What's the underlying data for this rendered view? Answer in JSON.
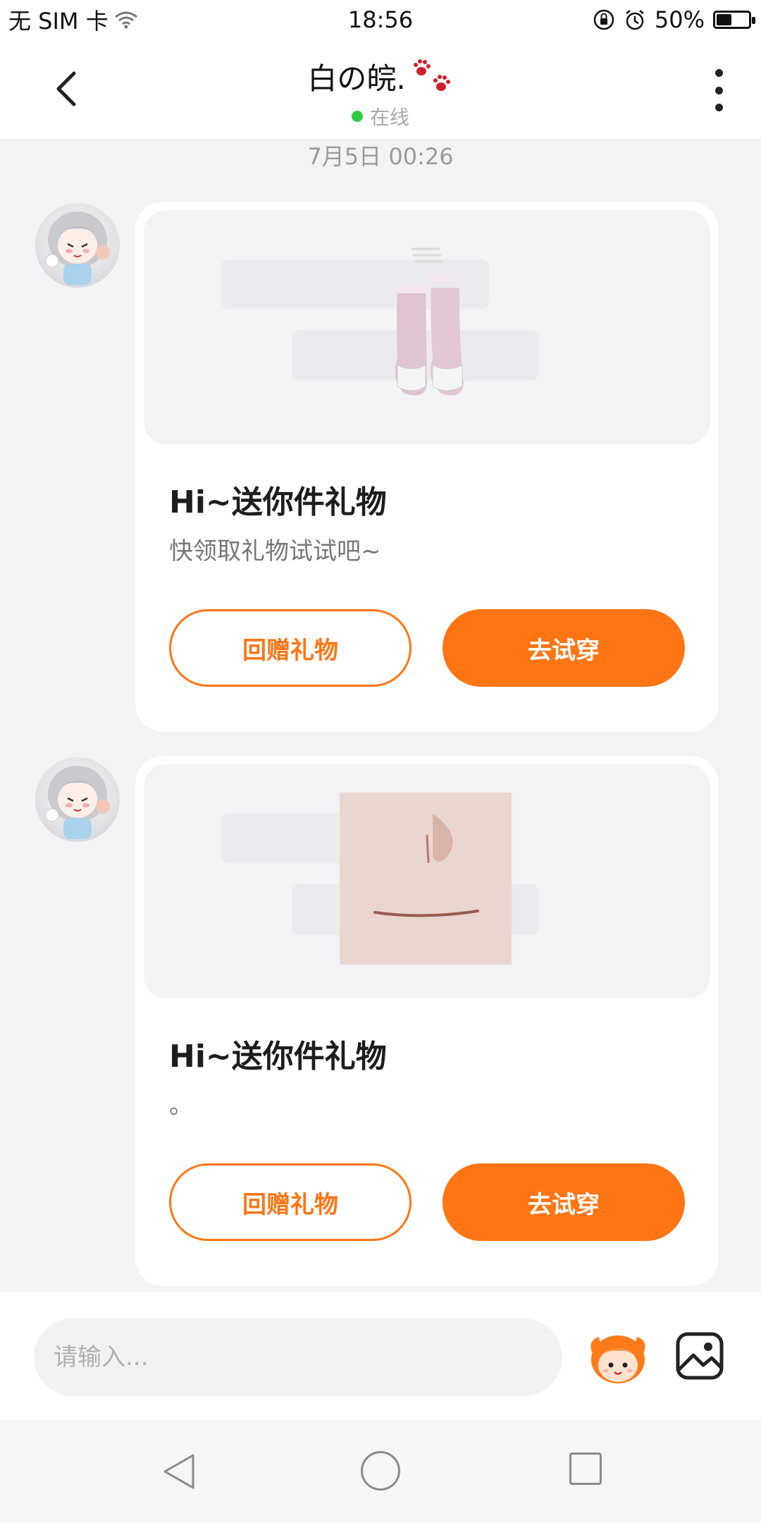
{
  "status_bar": {
    "carrier": "无 SIM 卡",
    "time": "18:56",
    "battery_percent": "50%",
    "battery_level": 0.5
  },
  "header": {
    "title": "白の皖.",
    "status": "在线"
  },
  "chat": {
    "timestamp": "7月5日 00:26",
    "messages": [
      {
        "item_type": "socks",
        "title": "Hi~送你件礼物",
        "subtitle": "快领取礼物试试吧~",
        "return_gift_label": "回赠礼物",
        "try_on_label": "去试穿"
      },
      {
        "item_type": "face",
        "title": "Hi~送你件礼物",
        "subtitle": "。",
        "return_gift_label": "回赠礼物",
        "try_on_label": "去试穿"
      }
    ]
  },
  "input_bar": {
    "placeholder": "请输入..."
  },
  "icons": {
    "back": "back-arrow-icon",
    "more": "more-vertical-icon",
    "mascot": "mascot-icon",
    "image": "image-icon"
  },
  "colors": {
    "accent": "#ff7514",
    "online": "#2ecc40",
    "background": "#f3f3f5"
  }
}
